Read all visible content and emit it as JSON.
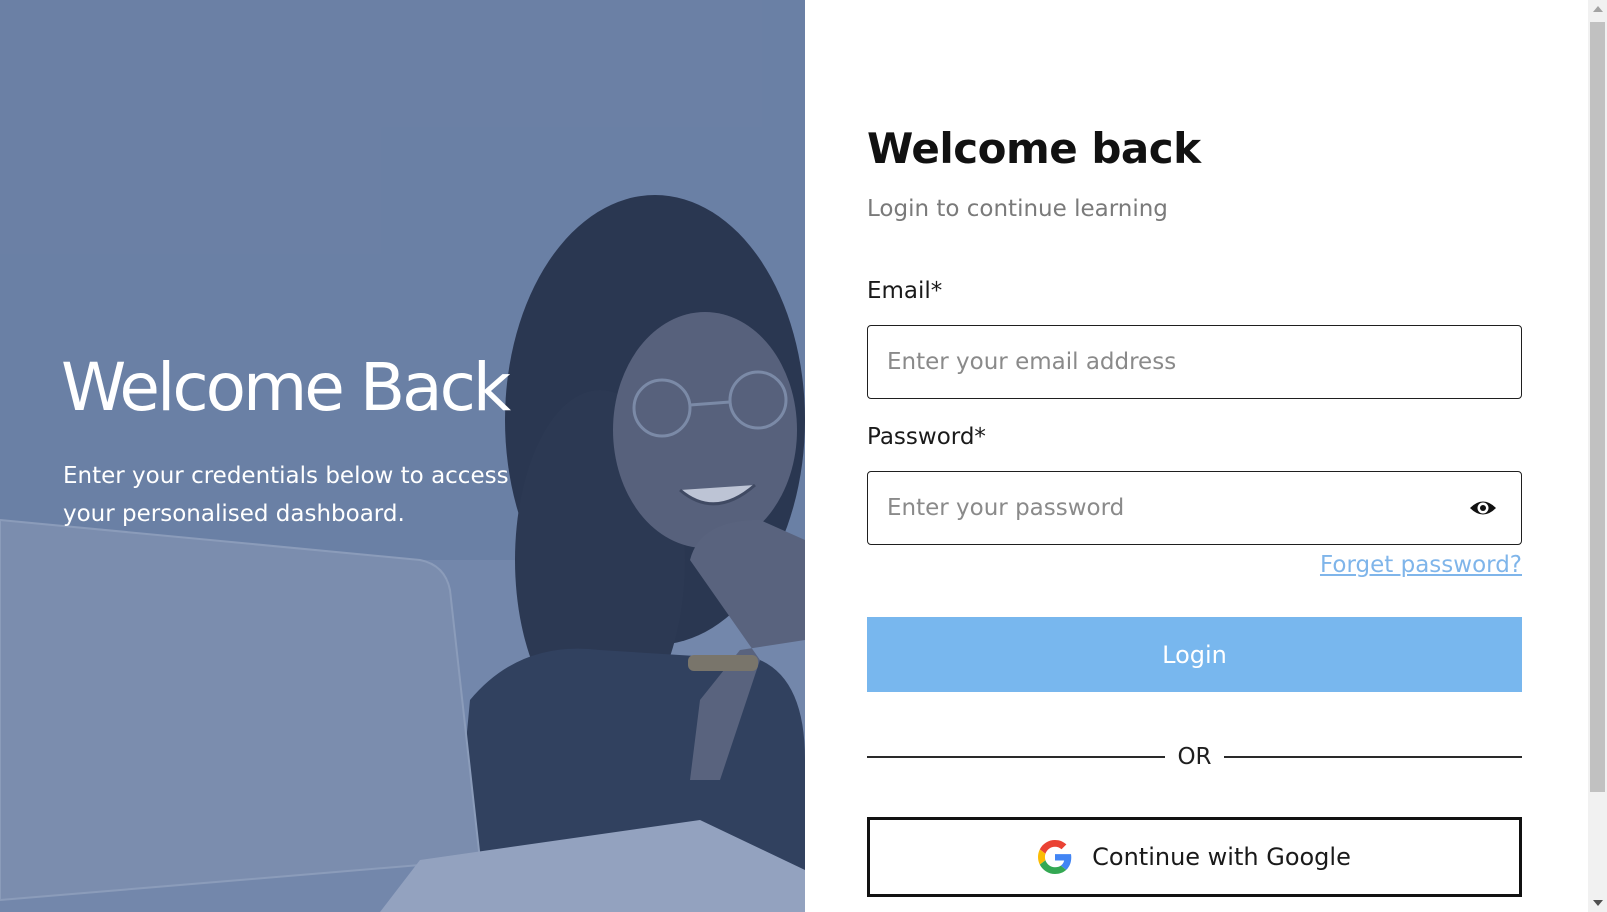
{
  "hero": {
    "title": "Welcome Back",
    "description": "Enter your credentials below to access your personalised dashboard.",
    "overlay_color": "#6f84a7"
  },
  "form": {
    "title": "Welcome back",
    "subtitle": "Login to continue learning",
    "email": {
      "label": "Email*",
      "placeholder": "Enter your email address",
      "value": ""
    },
    "password": {
      "label": "Password*",
      "placeholder": "Enter your password",
      "value": "",
      "toggle_icon": "eye-icon"
    },
    "forgot_password_label": "Forget password?",
    "login_label": "Login",
    "divider_label": "OR",
    "google_label": "Continue with Google",
    "google_icon": "google-icon"
  },
  "colors": {
    "primary_button": "#78b7ee",
    "link": "#7fb5ea",
    "text": "#111111",
    "muted_text": "#7a7a7a"
  }
}
